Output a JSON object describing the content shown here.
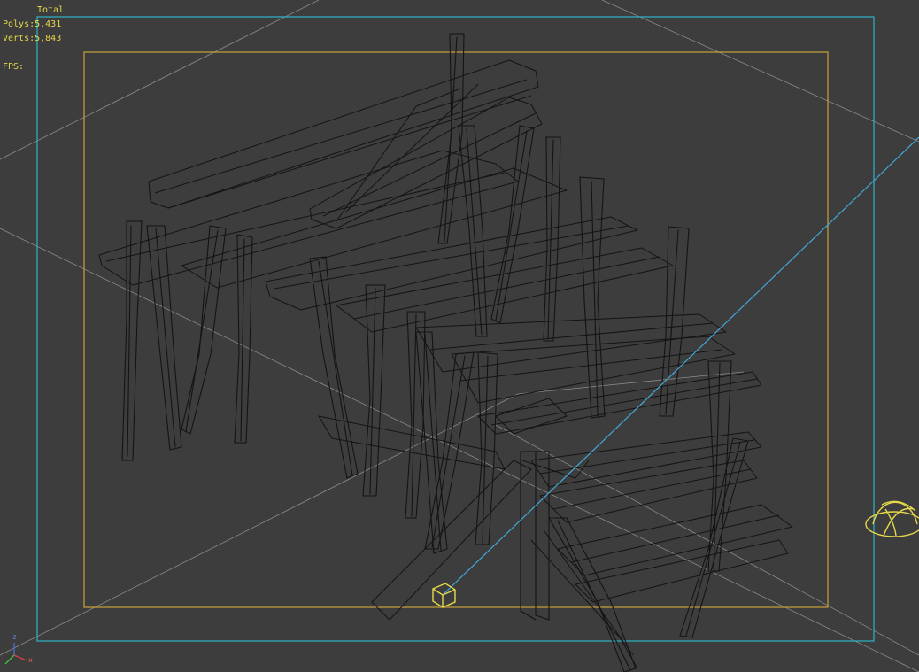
{
  "viewport": {
    "stats": {
      "total_label": "Total",
      "polys_label": "Polys:",
      "polys_value": "5,431",
      "verts_label": "Verts:",
      "verts_value": "5,843",
      "fps_label": "FPS:"
    },
    "axis_labels": {
      "x": "x",
      "y": "y",
      "z": "z"
    },
    "colors": {
      "background": "#3d3d3d",
      "safe_frame_outer": "#2fb3c9",
      "safe_frame_inner": "#c9a23a",
      "wireframe": "#141414",
      "grid_lines": "#8a8a8a",
      "selection_yellow": "#e6d84a",
      "camera_line": "#43a7d8"
    },
    "icons": {
      "camera_target": "yellow-cube-icon",
      "light_dome": "yellow-dome-icon",
      "tripod": "axis-tripod-icon"
    }
  }
}
